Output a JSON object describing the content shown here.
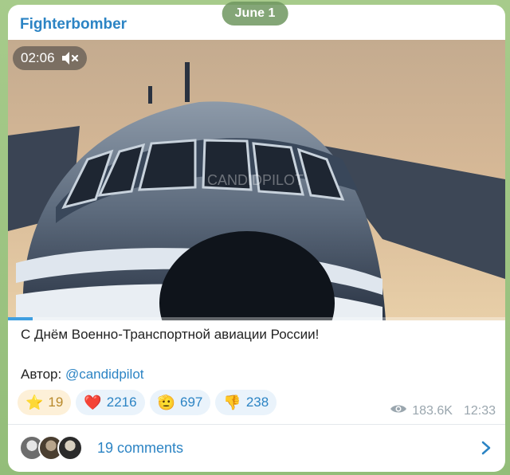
{
  "date_pill": "June 1",
  "channel": {
    "name": "Fighterbomber"
  },
  "video": {
    "time": "02:06",
    "watermark": "CANDIDPILOT",
    "progress": 0.05,
    "mute_icon": "muted-speaker-icon"
  },
  "message": {
    "text": "С Днём Военно-Транспортной авиации России!",
    "author_prefix": "Автор:",
    "author_handle": "@candidpilot"
  },
  "reactions": [
    {
      "icon": "star-icon",
      "glyph": "⭐",
      "count": "19"
    },
    {
      "icon": "heart-icon",
      "glyph": "❤️",
      "count": "2216"
    },
    {
      "icon": "pointing-hand-icon",
      "glyph": "🫡",
      "count": "697"
    },
    {
      "icon": "thumbs-down-icon",
      "glyph": "👎",
      "count": "238"
    }
  ],
  "meta": {
    "views": "183.6K",
    "time": "12:33",
    "views_icon": "eye-icon"
  },
  "comments": {
    "label": "19 comments",
    "chevron_icon": "chevron-right-icon"
  },
  "colors": {
    "accent": "#2c84c4",
    "background": "#9cc382",
    "progress": "#3f9fe0"
  }
}
